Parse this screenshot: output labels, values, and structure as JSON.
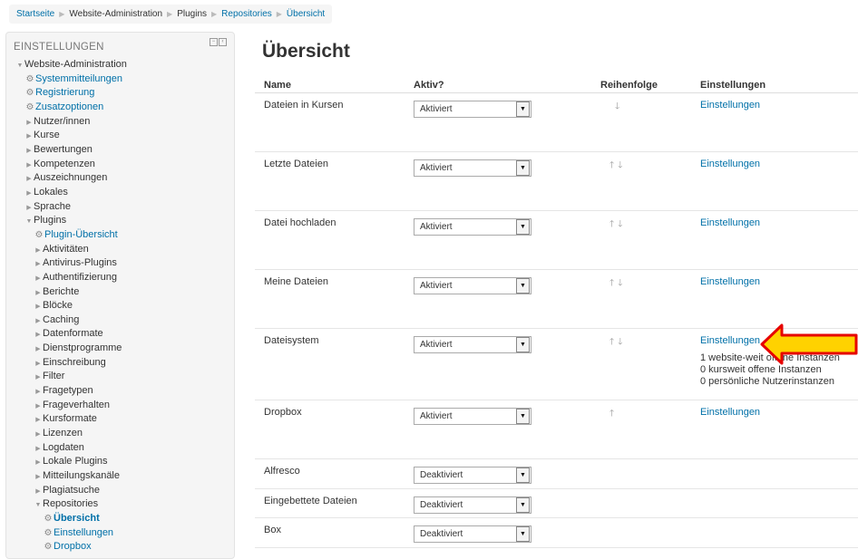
{
  "breadcrumb": [
    "Startseite",
    "Website-Administration",
    "Plugins",
    "Repositories",
    "Übersicht"
  ],
  "block": {
    "title": "EINSTELLUNGEN",
    "items": [
      {
        "label": "Website-Administration",
        "level": 0,
        "kind": "expanded"
      },
      {
        "label": "Systemmitteilungen",
        "level": 1,
        "kind": "gear-link"
      },
      {
        "label": "Registrierung",
        "level": 1,
        "kind": "gear-link"
      },
      {
        "label": "Zusatzoptionen",
        "level": 1,
        "kind": "gear-link"
      },
      {
        "label": "Nutzer/innen",
        "level": 1,
        "kind": "collapsed"
      },
      {
        "label": "Kurse",
        "level": 1,
        "kind": "collapsed"
      },
      {
        "label": "Bewertungen",
        "level": 1,
        "kind": "collapsed"
      },
      {
        "label": "Kompetenzen",
        "level": 1,
        "kind": "collapsed"
      },
      {
        "label": "Auszeichnungen",
        "level": 1,
        "kind": "collapsed"
      },
      {
        "label": "Lokales",
        "level": 1,
        "kind": "collapsed"
      },
      {
        "label": "Sprache",
        "level": 1,
        "kind": "collapsed"
      },
      {
        "label": "Plugins",
        "level": 1,
        "kind": "expanded"
      },
      {
        "label": "Plugin-Übersicht",
        "level": 2,
        "kind": "gear-link"
      },
      {
        "label": "Aktivitäten",
        "level": 2,
        "kind": "collapsed"
      },
      {
        "label": "Antivirus-Plugins",
        "level": 2,
        "kind": "collapsed"
      },
      {
        "label": "Authentifizierung",
        "level": 2,
        "kind": "collapsed"
      },
      {
        "label": "Berichte",
        "level": 2,
        "kind": "collapsed"
      },
      {
        "label": "Blöcke",
        "level": 2,
        "kind": "collapsed"
      },
      {
        "label": "Caching",
        "level": 2,
        "kind": "collapsed"
      },
      {
        "label": "Datenformate",
        "level": 2,
        "kind": "collapsed"
      },
      {
        "label": "Dienstprogramme",
        "level": 2,
        "kind": "collapsed"
      },
      {
        "label": "Einschreibung",
        "level": 2,
        "kind": "collapsed"
      },
      {
        "label": "Filter",
        "level": 2,
        "kind": "collapsed"
      },
      {
        "label": "Fragetypen",
        "level": 2,
        "kind": "collapsed"
      },
      {
        "label": "Frageverhalten",
        "level": 2,
        "kind": "collapsed"
      },
      {
        "label": "Kursformate",
        "level": 2,
        "kind": "collapsed"
      },
      {
        "label": "Lizenzen",
        "level": 2,
        "kind": "collapsed"
      },
      {
        "label": "Logdaten",
        "level": 2,
        "kind": "collapsed"
      },
      {
        "label": "Lokale Plugins",
        "level": 2,
        "kind": "collapsed"
      },
      {
        "label": "Mitteilungskanäle",
        "level": 2,
        "kind": "collapsed"
      },
      {
        "label": "Plagiatsuche",
        "level": 2,
        "kind": "collapsed"
      },
      {
        "label": "Repositories",
        "level": 2,
        "kind": "expanded"
      },
      {
        "label": "Übersicht",
        "level": 3,
        "kind": "gear-active"
      },
      {
        "label": "Einstellungen",
        "level": 3,
        "kind": "gear-link"
      },
      {
        "label": "Dropbox",
        "level": 3,
        "kind": "gear-link"
      }
    ]
  },
  "main": {
    "heading": "Übersicht",
    "columns": [
      "Name",
      "Aktiv?",
      "Reihenfolge",
      "Einstellungen"
    ],
    "rows": [
      {
        "name": "Dateien in Kursen",
        "status": "Aktiviert",
        "order": "down",
        "settings": "Einstellungen",
        "info": []
      },
      {
        "name": "Letzte Dateien",
        "status": "Aktiviert",
        "order": "updown",
        "settings": "Einstellungen",
        "info": []
      },
      {
        "name": "Datei hochladen",
        "status": "Aktiviert",
        "order": "updown",
        "settings": "Einstellungen",
        "info": []
      },
      {
        "name": "Meine Dateien",
        "status": "Aktiviert",
        "order": "updown",
        "settings": "Einstellungen",
        "info": []
      },
      {
        "name": "Dateisystem",
        "status": "Aktiviert",
        "order": "updown",
        "settings": "Einstellungen",
        "info": [
          "1 website-weit offene Instanzen",
          "0 kursweit offene Instanzen",
          "0 persönliche Nutzerinstanzen"
        ]
      },
      {
        "name": "Dropbox",
        "status": "Aktiviert",
        "order": "up",
        "settings": "Einstellungen",
        "info": []
      },
      {
        "name": "Alfresco",
        "status": "Deaktiviert",
        "order": "",
        "settings": "",
        "info": []
      },
      {
        "name": "Eingebettete Dateien",
        "status": "Deaktiviert",
        "order": "",
        "settings": "",
        "info": []
      },
      {
        "name": "Box",
        "status": "Deaktiviert",
        "order": "",
        "settings": "",
        "info": []
      }
    ]
  },
  "colors": {
    "link": "#0070a8",
    "arrow_fill": "#ffd200",
    "arrow_stroke": "#e60000"
  }
}
